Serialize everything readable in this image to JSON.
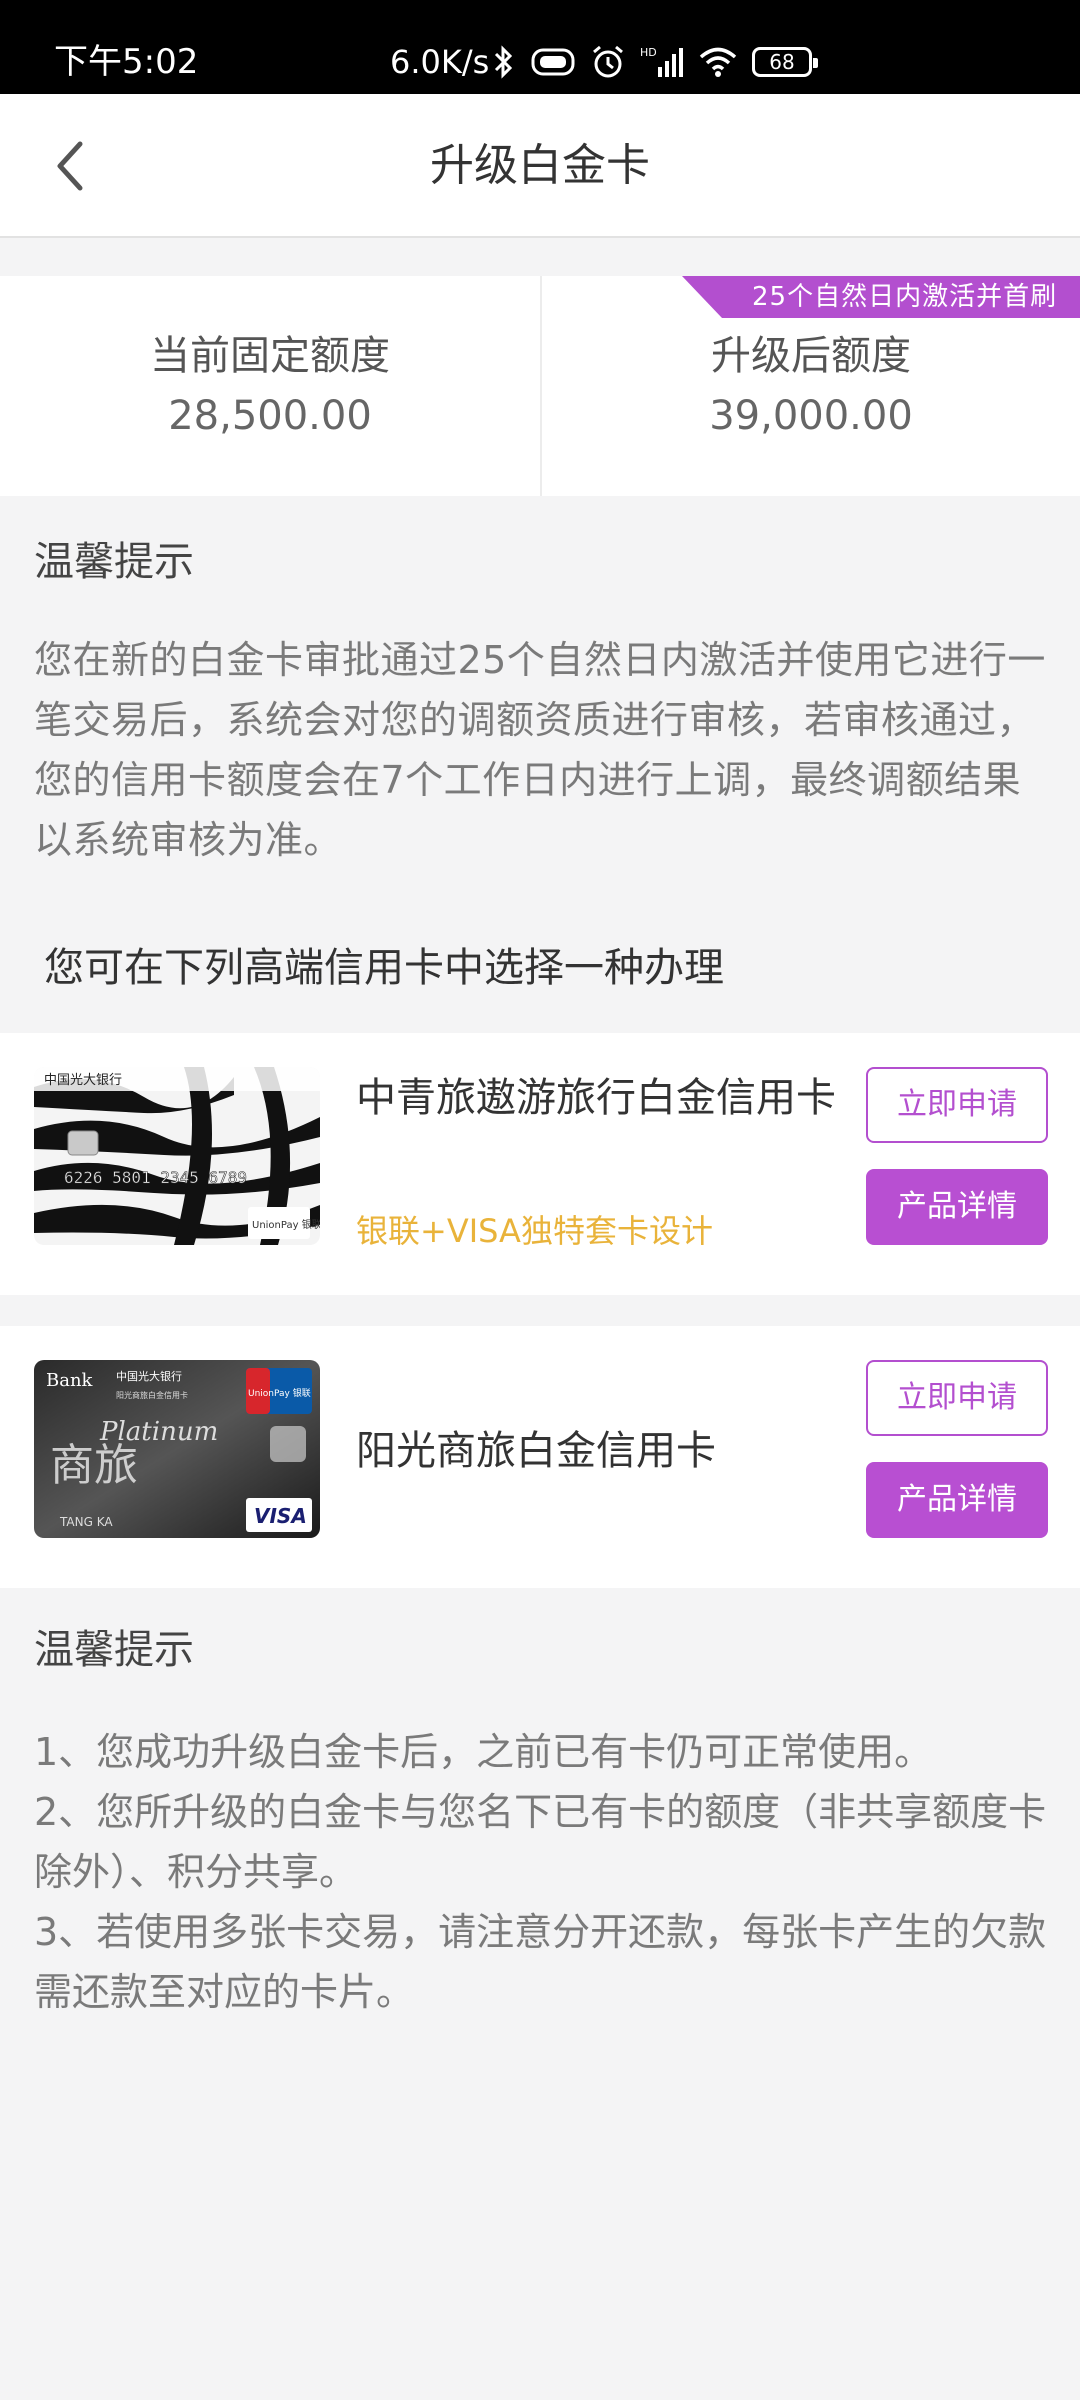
{
  "status_bar": {
    "time": "下午5:02",
    "net_speed": "6.0K/s",
    "battery": "68",
    "icons": [
      "bluetooth-icon",
      "vibrate-icon",
      "alarm-icon",
      "hd-signal-icon",
      "wifi-icon",
      "battery-icon"
    ]
  },
  "header": {
    "title": "升级白金卡",
    "back_icon": "chevron-left-icon"
  },
  "limits": {
    "current_label": "当前固定额度",
    "current_value": "28,500.00",
    "upgraded_label": "升级后额度",
    "upgraded_value": "39,000.00",
    "badge": "25个自然日内激活并首刷"
  },
  "tip1": {
    "title": "温馨提示",
    "body": "您在新的白金卡审批通过25个自然日内激活并使用它进行一笔交易后，系统会对您的调额资质进行审核，若审核通过，您的信用卡额度会在7个工作日内进行上调，最终调额结果以系统审核为准。"
  },
  "choose_title": "您可在下列高端信用卡中选择一种办理",
  "cards": [
    {
      "name": "中青旅遨游旅行白金信用卡",
      "subtitle": "银联+VISA独特套卡设计",
      "apply_label": "立即申请",
      "detail_label": "产品详情",
      "image_text": {
        "bank": "中国光大银行",
        "number": "6226 5801 2345 6789",
        "brand": "UnionPay 银联"
      }
    },
    {
      "name": "阳光商旅白金信用卡",
      "apply_label": "立即申请",
      "detail_label": "产品详情",
      "image_text": {
        "bank": "中国光大银行",
        "product": "阳光商旅白金信用卡",
        "tier": "Platinum",
        "holder": "TANG KA",
        "brand": "VISA",
        "union": "UnionPay 银联"
      }
    }
  ],
  "tip2": {
    "title": "温馨提示",
    "items": [
      "1、您成功升级白金卡后，之前已有卡仍可正常使用。",
      "2、您所升级的白金卡与您名下已有卡的额度（非共享额度卡除外）、积分共享。",
      "3、若使用多张卡交易，请注意分开还款，每张卡产生的欠款需还款至对应的卡片。"
    ]
  },
  "colors": {
    "accent": "#b34fcf",
    "subtitle": "#e9b33a",
    "page_bg": "#f4f4f5"
  }
}
